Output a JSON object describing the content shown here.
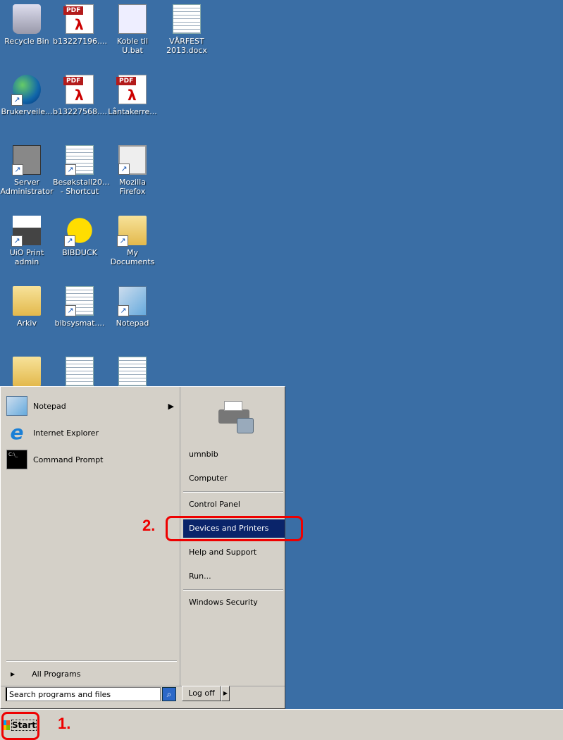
{
  "desktop": {
    "icons": [
      {
        "label": "Recycle Bin",
        "type": "bin"
      },
      {
        "label": "b13227196....",
        "type": "pdf"
      },
      {
        "label": "Koble til U.bat",
        "type": "bat"
      },
      {
        "label": "VÅRFEST 2013.docx",
        "type": "doc"
      },
      {
        "label": "Brukerveile...",
        "type": "globe"
      },
      {
        "label": "b13227568....",
        "type": "pdf"
      },
      {
        "label": "Låntakerre...",
        "type": "pdf"
      },
      {
        "label": "Server Administrator",
        "type": "server"
      },
      {
        "label": "Besøkstall20... - Shortcut",
        "type": "excel"
      },
      {
        "label": "Mozilla Firefox",
        "type": "window"
      },
      {
        "label": "UiO Print admin",
        "type": "printer"
      },
      {
        "label": "BIBDUCK",
        "type": "duck"
      },
      {
        "label": "My Documents",
        "type": "folder"
      },
      {
        "label": "Arkiv",
        "type": "folder"
      },
      {
        "label": "bibsysmat....",
        "type": "doc"
      },
      {
        "label": "Notepad",
        "type": "notepad"
      }
    ]
  },
  "start_menu": {
    "pinned": [
      {
        "label": "Notepad",
        "icon": "notepad-icon",
        "submenu": true
      },
      {
        "label": "Internet Explorer",
        "icon": "ie-icon"
      },
      {
        "label": "Command Prompt",
        "icon": "cmd-icon"
      }
    ],
    "all_programs": "All Programs",
    "search_placeholder": "Search programs and files",
    "right": [
      "umnbib",
      "Computer",
      "Control Panel",
      "Devices and Printers",
      "Help and Support",
      "Run...",
      "Windows Security"
    ],
    "selected": "Devices and Printers",
    "logoff": "Log off"
  },
  "taskbar": {
    "start": "Start"
  },
  "annotations": {
    "step1": "1.",
    "step2": "2.",
    "color": "#e00000"
  }
}
